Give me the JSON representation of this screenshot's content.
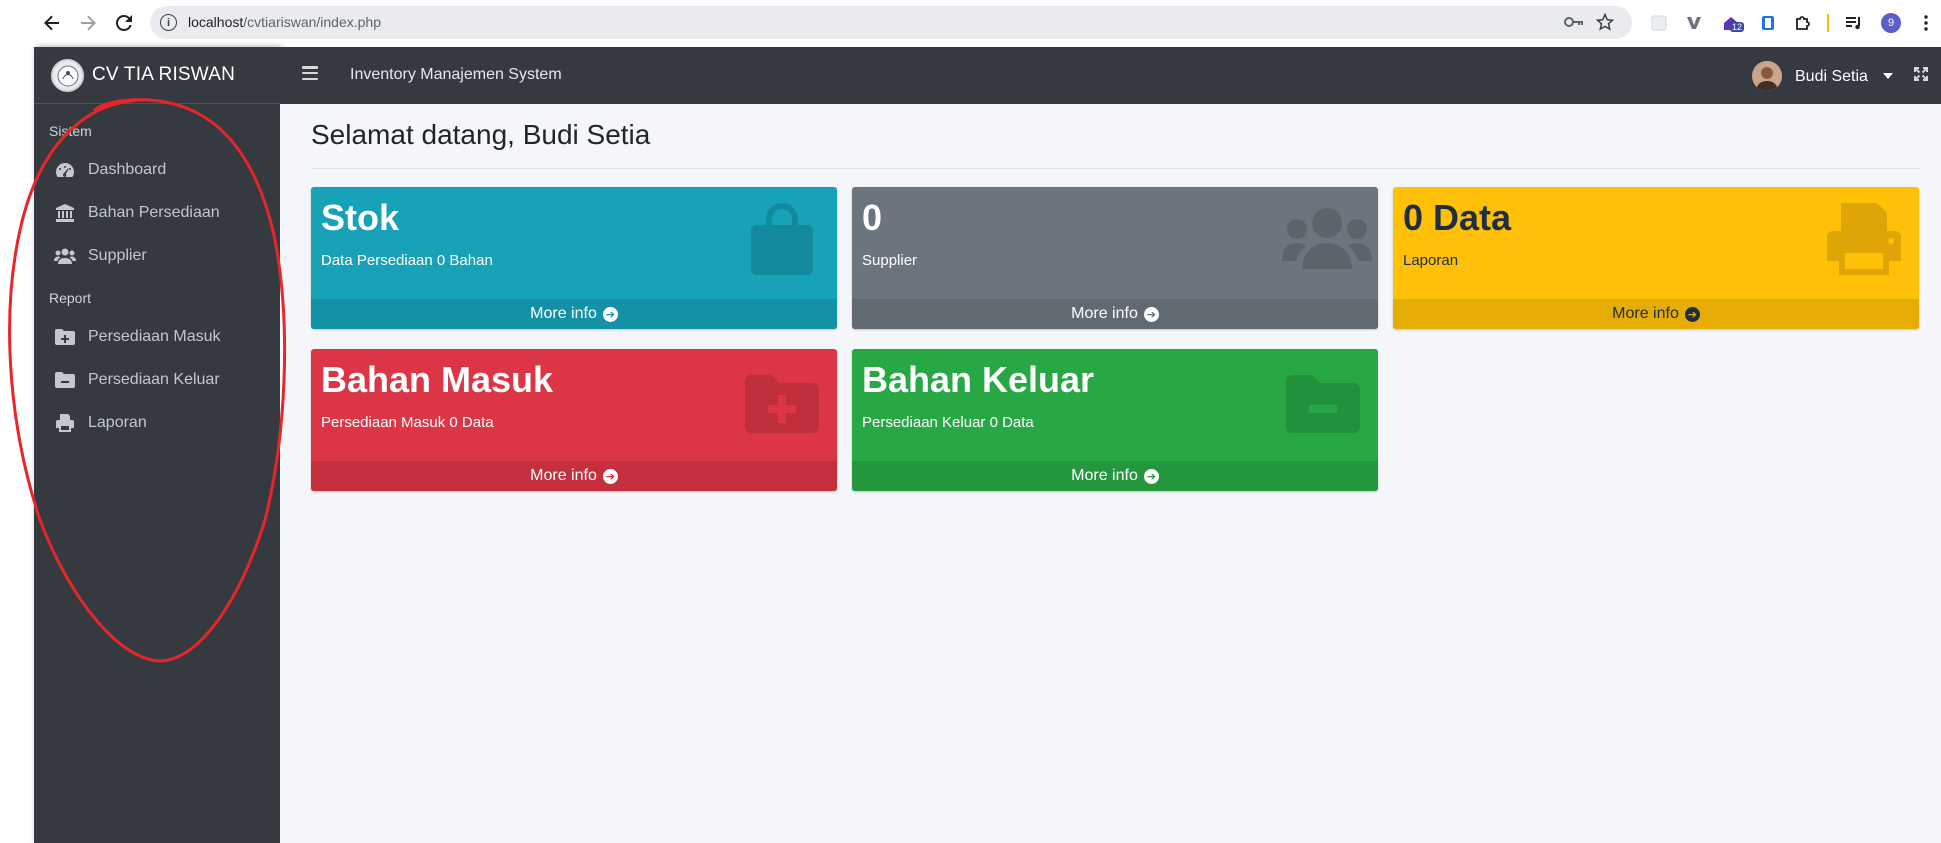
{
  "browser": {
    "url_host": "localhost",
    "url_path": "/cvtiariswan/index.php",
    "extension_badge": "12",
    "profile_letter": "9"
  },
  "sidebar": {
    "brand": "CV TIA RISWAN",
    "sections": [
      {
        "header": "Sistem"
      },
      {
        "header": "Report"
      }
    ],
    "items": [
      {
        "label": "Dashboard",
        "icon": "tachometer-icon"
      },
      {
        "label": "Bahan Persediaan",
        "icon": "university-icon"
      },
      {
        "label": "Supplier",
        "icon": "users-icon"
      },
      {
        "label": "Persediaan Masuk",
        "icon": "folder-plus-icon"
      },
      {
        "label": "Persediaan Keluar",
        "icon": "folder-minus-icon"
      },
      {
        "label": "Laporan",
        "icon": "print-icon"
      }
    ]
  },
  "topnav": {
    "title": "Inventory Manajemen System",
    "user_name": "Budi Setia"
  },
  "main": {
    "welcome": "Selamat datang, Budi Setia",
    "boxes": [
      {
        "value": "Stok",
        "subtitle": "Data Persediaan 0 Bahan",
        "footer": "More info",
        "color": "#17a2b8",
        "footer_color": "#1591a5",
        "icon": "shopping-bag-icon"
      },
      {
        "value": "0",
        "subtitle": "Supplier",
        "footer": "More info",
        "color": "#6c757d",
        "footer_color": "#616971",
        "icon": "users-icon"
      },
      {
        "value": "0 Data",
        "subtitle": "Laporan",
        "footer": "More info",
        "color": "#ffc107",
        "footer_color": "#e5ad06",
        "icon": "print-icon"
      },
      {
        "value": "Bahan Masuk",
        "subtitle": "Persediaan Masuk 0 Data",
        "footer": "More info",
        "color": "#dc3545",
        "footer_color": "#c62f3e",
        "icon": "folder-plus-icon"
      },
      {
        "value": "Bahan Keluar",
        "subtitle": "Persediaan Keluar 0 Data",
        "footer": "More info",
        "color": "#28a745",
        "footer_color": "#24963e",
        "icon": "folder-minus-icon"
      }
    ]
  },
  "annotation": {
    "color": "#e8262a",
    "shape": "hand-drawn ellipse around sidebar"
  }
}
